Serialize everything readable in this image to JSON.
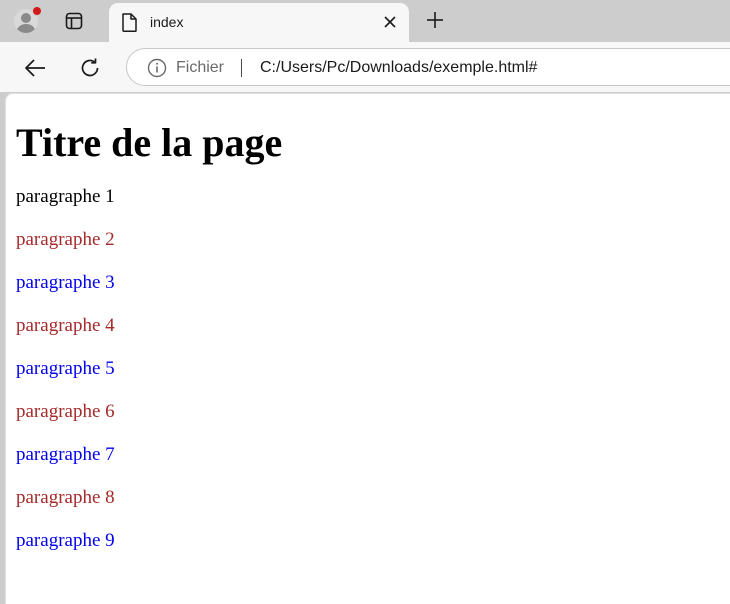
{
  "browser": {
    "tab": {
      "title": "index"
    },
    "omnibox": {
      "site_info_label": "Fichier",
      "url": "C:/Users/Pc/Downloads/exemple.html#"
    },
    "colors": {
      "frame": "#cdcdcd",
      "toolbar": "#f7f7f7",
      "notification_dot": "#d11a1a"
    }
  },
  "page": {
    "heading": "Titre de la page",
    "paragraphs": [
      {
        "text": "paragraphe 1",
        "color": "#000000"
      },
      {
        "text": "paragraphe 2",
        "color": "#a52a2a"
      },
      {
        "text": "paragraphe 3",
        "color": "#0000ee"
      },
      {
        "text": "paragraphe 4",
        "color": "#a52a2a"
      },
      {
        "text": "paragraphe 5",
        "color": "#0000ee"
      },
      {
        "text": "paragraphe 6",
        "color": "#a52a2a"
      },
      {
        "text": "paragraphe 7",
        "color": "#0000ee"
      },
      {
        "text": "paragraphe 8",
        "color": "#a52a2a"
      },
      {
        "text": "paragraphe 9",
        "color": "#0000ee"
      }
    ]
  }
}
